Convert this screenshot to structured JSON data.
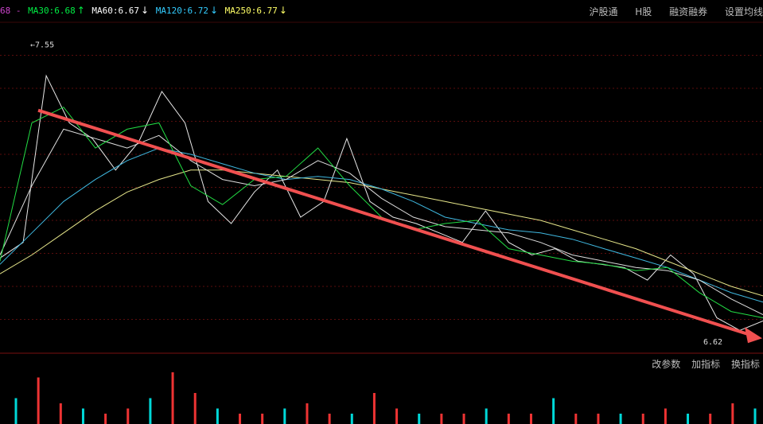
{
  "legend": {
    "prefix": "68 -",
    "ma30": {
      "label": "MA30:6.68",
      "arrow": "↑",
      "color": "#00ee44"
    },
    "ma60": {
      "label": "MA60:6.67",
      "arrow": "↓",
      "color": "#ffffff"
    },
    "ma120": {
      "label": "MA120:6.72",
      "arrow": "↓",
      "color": "#33ccff"
    },
    "ma250": {
      "label": "MA250:6.77",
      "arrow": "↓",
      "color": "#ffff66"
    }
  },
  "tabs": [
    "沪股通",
    "H股",
    "融资融券",
    "设置均线"
  ],
  "subtabs": [
    "改参数",
    "加指标",
    "换指标"
  ],
  "chart_data": {
    "type": "line",
    "series": [
      {
        "name": "MA250",
        "values": [
          6.82,
          6.88,
          6.95,
          7.02,
          7.08,
          7.12,
          7.15,
          7.15,
          7.14,
          7.13,
          7.12,
          7.11,
          7.09,
          7.07,
          7.05,
          7.03,
          7.01,
          6.99,
          6.96,
          6.93,
          6.9,
          6.86,
          6.82,
          6.78,
          6.75
        ]
      },
      {
        "name": "MA120",
        "values": [
          6.85,
          6.95,
          7.05,
          7.12,
          7.18,
          7.22,
          7.2,
          7.17,
          7.14,
          7.12,
          7.13,
          7.12,
          7.09,
          7.05,
          7.0,
          6.98,
          6.96,
          6.95,
          6.93,
          6.9,
          6.87,
          6.84,
          6.8,
          6.76,
          6.73
        ]
      },
      {
        "name": "MA60",
        "values": [
          6.88,
          7.1,
          7.28,
          7.25,
          7.22,
          7.26,
          7.18,
          7.12,
          7.1,
          7.12,
          7.18,
          7.14,
          7.06,
          7.0,
          6.97,
          6.96,
          6.95,
          6.92,
          6.88,
          6.86,
          6.84,
          6.83,
          6.8,
          6.74,
          6.69
        ]
      },
      {
        "name": "MA30",
        "values": [
          6.86,
          7.3,
          7.35,
          7.22,
          7.28,
          7.3,
          7.1,
          7.04,
          7.12,
          7.13,
          7.22,
          7.1,
          7.0,
          6.96,
          6.98,
          6.99,
          6.9,
          6.88,
          6.86,
          6.85,
          6.83,
          6.84,
          6.76,
          6.7,
          6.68
        ]
      }
    ],
    "price": [
      6.87,
      6.92,
      7.45,
      7.3,
      7.25,
      7.15,
      7.24,
      7.4,
      7.3,
      7.05,
      6.98,
      7.08,
      7.15,
      7.0,
      7.05,
      7.25,
      7.05,
      7.0,
      6.98,
      6.95,
      6.92,
      7.02,
      6.92,
      6.88,
      6.9,
      6.86,
      6.85,
      6.84,
      6.8,
      6.88,
      6.82,
      6.68,
      6.64,
      6.67
    ],
    "annotations": [
      {
        "text": "7.55",
        "value": 7.55
      },
      {
        "text": "6.62",
        "value": 6.62
      }
    ],
    "ylim": [
      6.57,
      7.62
    ],
    "trend": {
      "from": 7.34,
      "to": 6.62
    },
    "volume": [
      0.5,
      0.9,
      0.4,
      0.3,
      0.2,
      0.3,
      0.5,
      1.0,
      0.6,
      0.3,
      0.2,
      0.2,
      0.3,
      0.4,
      0.2,
      0.2,
      0.6,
      0.3,
      0.2,
      0.2,
      0.2,
      0.3,
      0.2,
      0.2,
      0.5,
      0.2,
      0.2,
      0.2,
      0.2,
      0.3,
      0.2,
      0.2,
      0.4,
      0.3
    ],
    "grid": true
  }
}
